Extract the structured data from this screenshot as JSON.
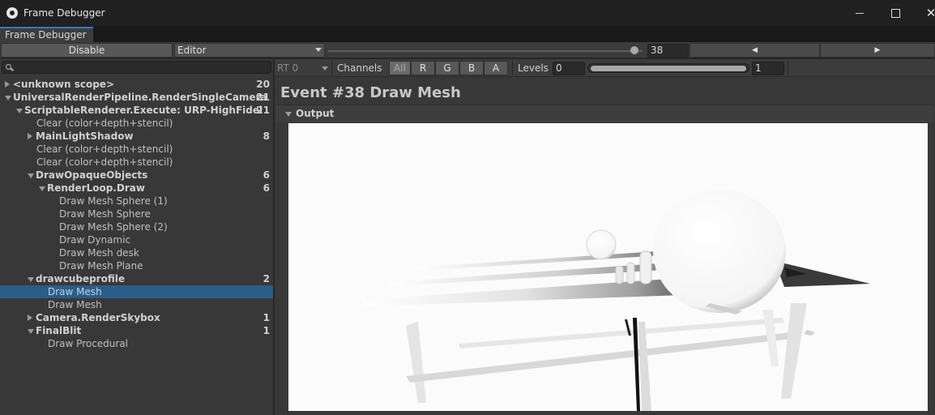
{
  "window": {
    "title": "Frame Debugger"
  },
  "tab": {
    "label": "Frame Debugger"
  },
  "toolbar": {
    "disable_label": "Disable",
    "target_dropdown": "Editor",
    "event_slider": {
      "value": 38,
      "min": 1,
      "max": 39
    },
    "event_index": "38",
    "prev_icon": "triangle-left-icon",
    "next_icon": "triangle-right-icon"
  },
  "search": {
    "placeholder": ""
  },
  "tree": [
    {
      "label": "<unknown scope>",
      "count": "20",
      "group": true,
      "depth": 0,
      "toggle": "closed"
    },
    {
      "label": "UniversalRenderPipeline.RenderSingleCamera",
      "count": "21",
      "group": true,
      "depth": 0,
      "toggle": "open"
    },
    {
      "label": "ScriptableRenderer.Execute: URP-HighFidel",
      "count": "21",
      "group": true,
      "depth": 1,
      "toggle": "open"
    },
    {
      "label": "Clear (color+depth+stencil)",
      "count": "",
      "group": false,
      "depth": 2,
      "toggle": ""
    },
    {
      "label": "MainLightShadow",
      "count": "8",
      "group": true,
      "depth": 2,
      "toggle": "closed"
    },
    {
      "label": "Clear (color+depth+stencil)",
      "count": "",
      "group": false,
      "depth": 2,
      "toggle": ""
    },
    {
      "label": "Clear (color+depth+stencil)",
      "count": "",
      "group": false,
      "depth": 2,
      "toggle": ""
    },
    {
      "label": "DrawOpaqueObjects",
      "count": "6",
      "group": true,
      "depth": 2,
      "toggle": "open"
    },
    {
      "label": "RenderLoop.Draw",
      "count": "6",
      "group": true,
      "depth": 3,
      "toggle": "open"
    },
    {
      "label": "Draw Mesh Sphere (1)",
      "count": "",
      "group": false,
      "depth": 4,
      "toggle": ""
    },
    {
      "label": "Draw Mesh Sphere",
      "count": "",
      "group": false,
      "depth": 4,
      "toggle": ""
    },
    {
      "label": "Draw Mesh Sphere (2)",
      "count": "",
      "group": false,
      "depth": 4,
      "toggle": ""
    },
    {
      "label": "Draw Dynamic",
      "count": "",
      "group": false,
      "depth": 4,
      "toggle": ""
    },
    {
      "label": "Draw Mesh desk",
      "count": "",
      "group": false,
      "depth": 4,
      "toggle": ""
    },
    {
      "label": "Draw Mesh Plane",
      "count": "",
      "group": false,
      "depth": 4,
      "toggle": ""
    },
    {
      "label": "drawcubeprofile",
      "count": "2",
      "group": true,
      "depth": 2,
      "toggle": "open"
    },
    {
      "label": "Draw Mesh",
      "count": "",
      "group": false,
      "depth": 3,
      "toggle": "",
      "selected": true
    },
    {
      "label": "Draw Mesh",
      "count": "",
      "group": false,
      "depth": 3,
      "toggle": ""
    },
    {
      "label": "Camera.RenderSkybox",
      "count": "1",
      "group": true,
      "depth": 2,
      "toggle": "closed"
    },
    {
      "label": "FinalBlit",
      "count": "1",
      "group": true,
      "depth": 2,
      "toggle": "open"
    },
    {
      "label": "Draw Procedural",
      "count": "",
      "group": false,
      "depth": 3,
      "toggle": ""
    }
  ],
  "rt_bar": {
    "rt_label": "RT 0",
    "channels_label": "Channels",
    "channel_all": "All",
    "channel_r": "R",
    "channel_g": "G",
    "channel_b": "B",
    "channel_a": "A",
    "levels_label": "Levels",
    "levels_min": "0",
    "levels_max": "1"
  },
  "event": {
    "title": "Event #38 Draw Mesh"
  },
  "output": {
    "label": "Output"
  },
  "colors": {
    "selection": "#2c5d87",
    "accent": "#3a79bb",
    "panel": "#383838"
  }
}
